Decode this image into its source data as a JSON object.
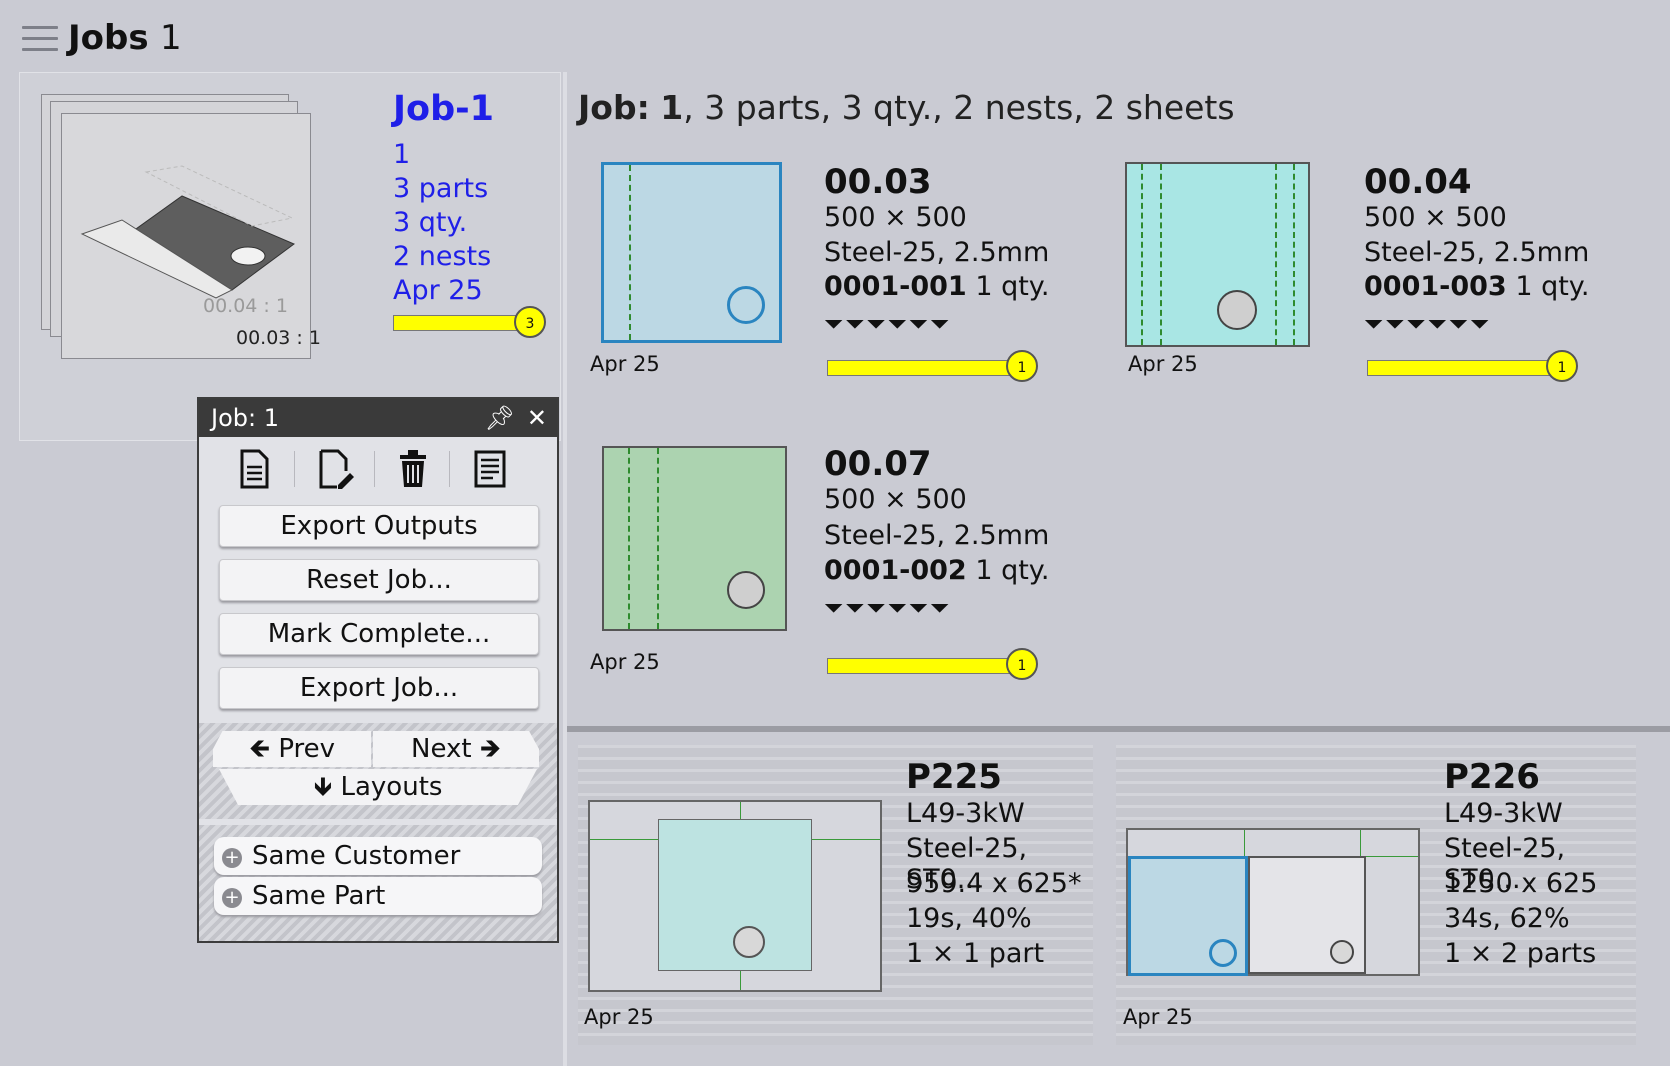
{
  "header": {
    "title": "Jobs",
    "count": "1"
  },
  "job_card": {
    "name": "Job-1",
    "lines": [
      "1",
      "3 parts",
      "3 qty.",
      "2 nests",
      "Apr 25"
    ],
    "thumb_caption_front": "00.03 : 1",
    "thumb_caption_back": "00.04 : 1",
    "progress_count": "3",
    "progress_fraction": 1.0
  },
  "job_summary": {
    "label": "Job:",
    "id": "1",
    "rest": ", 3 parts, 3 qty., 2 nests, 2 sheets"
  },
  "parts": [
    {
      "name": "00.03",
      "size": "500 × 500",
      "material": "Steel-25, 2.5mm",
      "code": "0001-001",
      "qty": "1 qty.",
      "date": "Apr 25",
      "count": "1",
      "color": "#bcd8e4"
    },
    {
      "name": "00.04",
      "size": "500 × 500",
      "material": "Steel-25, 2.5mm",
      "code": "0001-003",
      "qty": "1 qty.",
      "date": "Apr 25",
      "count": "1",
      "color": "#a9e6e4"
    },
    {
      "name": "00.07",
      "size": "500 × 500",
      "material": "Steel-25, 2.5mm",
      "code": "0001-002",
      "qty": "1 qty.",
      "date": "Apr 25",
      "count": "1",
      "color": "#acd3b0"
    }
  ],
  "bend_icons": "⏷⏷⏷⏷⏷⏷",
  "nests": [
    {
      "name": "P225",
      "machine": "L49-3kW",
      "material": "Steel-25, ST0...",
      "sheet": "959.4 x 625*",
      "time": "19s, 40%",
      "parts": "1 × 1 part",
      "date": "Apr 25"
    },
    {
      "name": "P226",
      "machine": "L49-3kW",
      "material": "Steel-25, ST0...",
      "sheet": "1250 x 625",
      "time": "34s, 62%",
      "parts": "1 × 2 parts",
      "date": "Apr 25"
    }
  ],
  "popup": {
    "title_label": "Job:",
    "title_id": "1",
    "pin_icon": "pin-icon",
    "close_icon": "close-icon",
    "buttons": [
      "Export Outputs",
      "Reset Job...",
      "Mark Complete...",
      "Export Job..."
    ],
    "prev": "Prev",
    "next": "Next",
    "layouts": "Layouts",
    "same_customer": "Same Customer",
    "same_part": "Same Part"
  }
}
